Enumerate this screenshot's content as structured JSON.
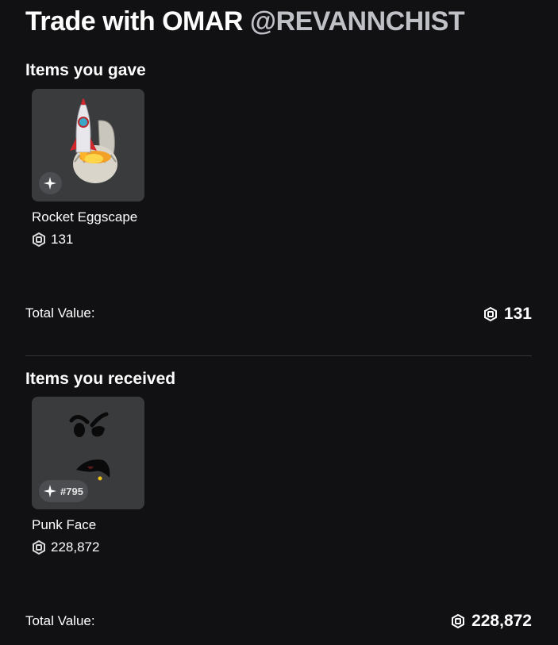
{
  "header": {
    "title": "Trade with OMAR",
    "username": "@REVANNCHIST"
  },
  "gave": {
    "heading": "Items you gave",
    "items": [
      {
        "name": "Rocket Eggscape",
        "price": "131",
        "badge_icon": "limited-sparkle-icon"
      }
    ],
    "total_label": "Total Value:",
    "total_value": "131"
  },
  "received": {
    "heading": "Items you received",
    "items": [
      {
        "name": "Punk Face",
        "price": "228,872",
        "badge_icon": "limited-sparkle-icon",
        "serial": "#795"
      }
    ],
    "total_label": "Total Value:",
    "total_value": "228,872"
  },
  "icons": {
    "currency": "robux-icon"
  },
  "colors": {
    "background": "#111114",
    "card": "#393b3d",
    "username": "#bfc1c6"
  }
}
